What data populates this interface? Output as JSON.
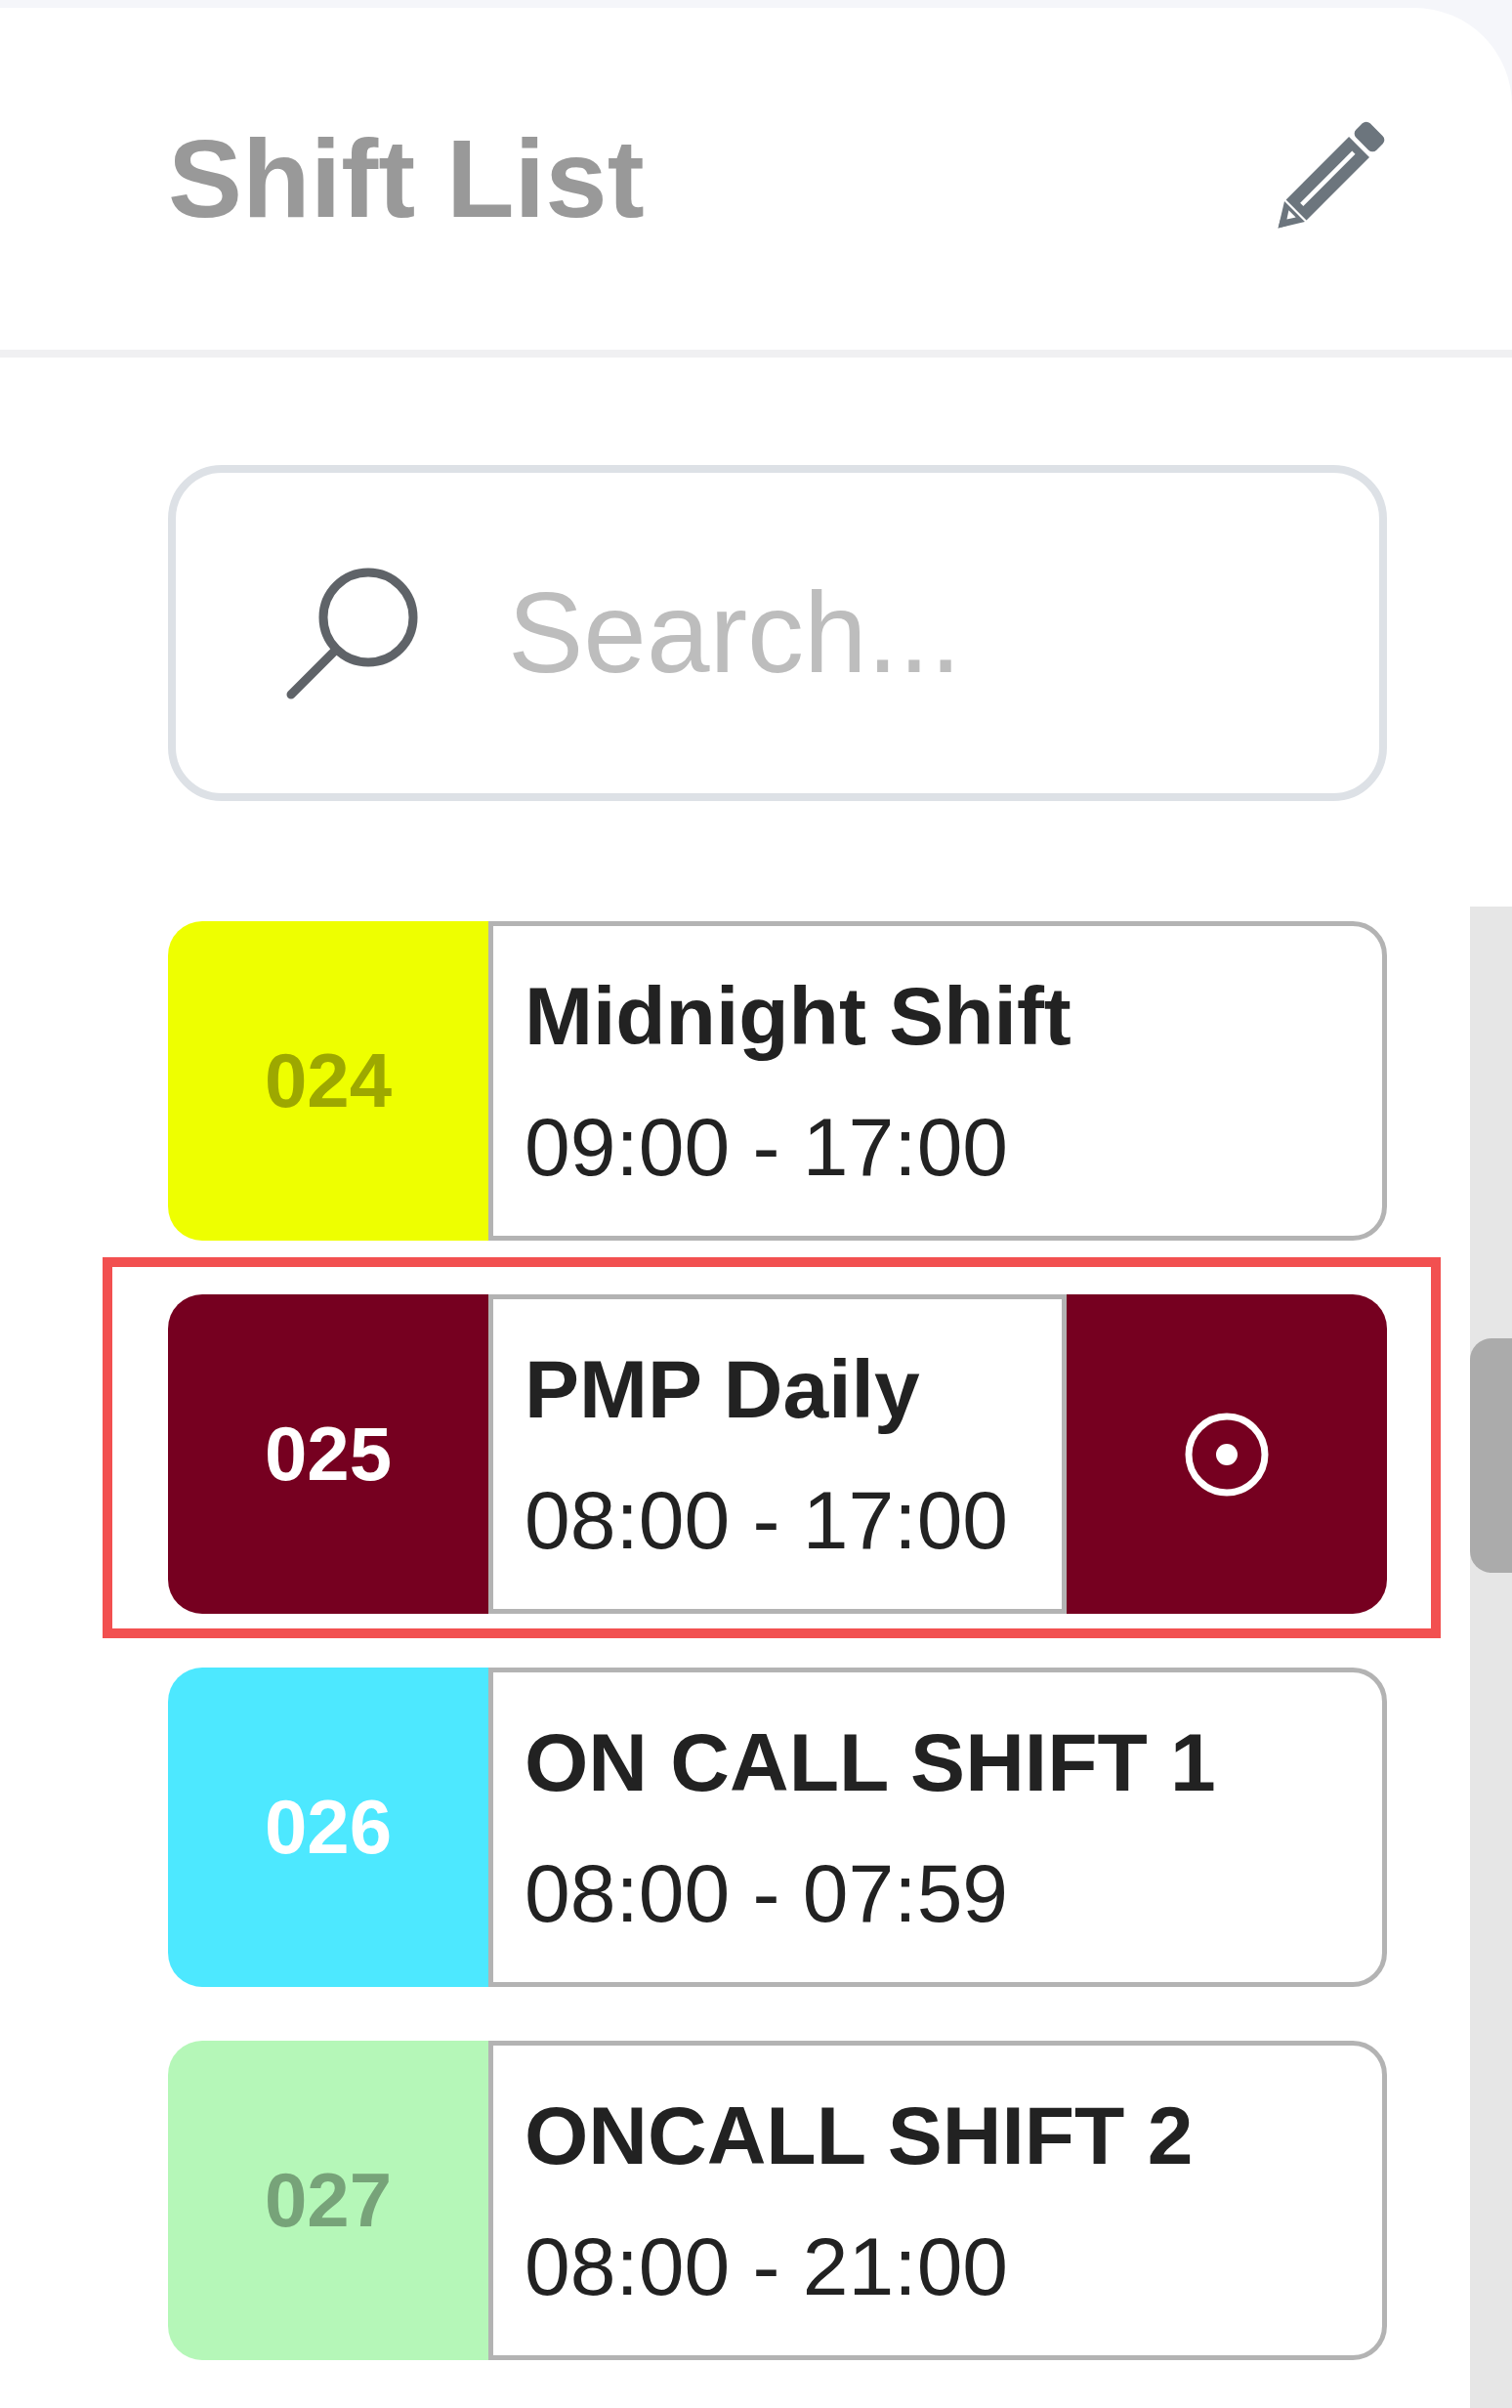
{
  "header": {
    "title": "Shift List"
  },
  "search": {
    "placeholder": "Search..."
  },
  "shifts": [
    {
      "code": "024",
      "name": "Midnight Shift",
      "hours": "09:00 - 17:00",
      "color": "#eeff00",
      "selected": false
    },
    {
      "code": "025",
      "name": "PMP Daily",
      "hours": "08:00 - 17:00",
      "color": "#760020",
      "selected": true
    },
    {
      "code": "026",
      "name": "ON CALL SHIFT 1",
      "hours": "08:00 - 07:59",
      "color": "#4de8ff",
      "selected": false
    },
    {
      "code": "027",
      "name": "ONCALL SHIFT 2",
      "hours": "08:00 - 21:00",
      "color": "#b5f7b8",
      "selected": false
    }
  ]
}
